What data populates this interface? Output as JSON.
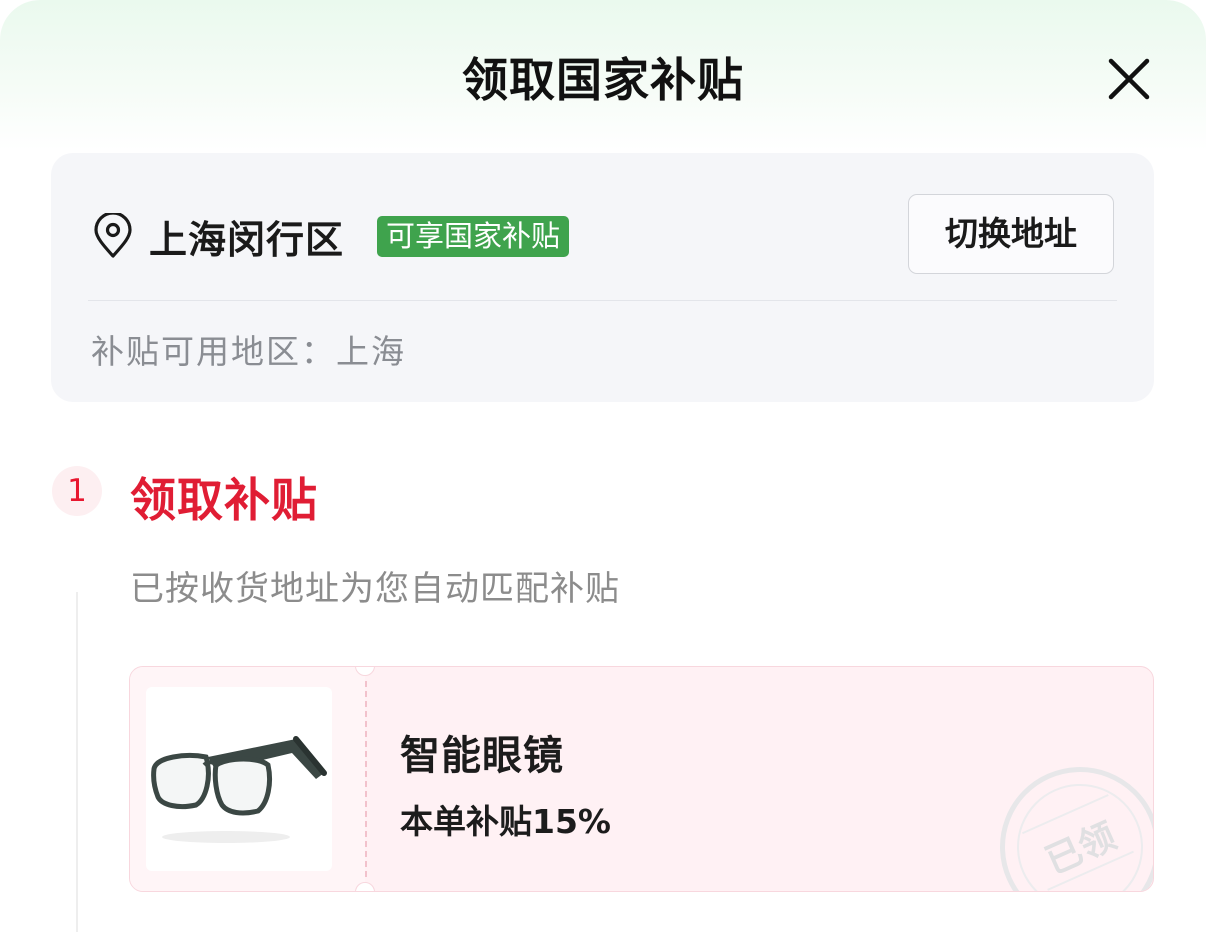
{
  "header": {
    "title": "领取国家补贴"
  },
  "address": {
    "name": "上海闵行区",
    "badge": "可享国家补贴",
    "switch_label": "切换地址",
    "region_text": "补贴可用地区：上海"
  },
  "step": {
    "number": "1",
    "title": "领取补贴",
    "description": "已按收货地址为您自动匹配补贴"
  },
  "coupon": {
    "product_name": "智能眼镜",
    "subsidy_text": "本单补贴15%",
    "stamp_text": "已领",
    "product_image": "smart-glasses"
  },
  "colors": {
    "accent_red": "#e01d34",
    "badge_green": "#3fa34d"
  }
}
